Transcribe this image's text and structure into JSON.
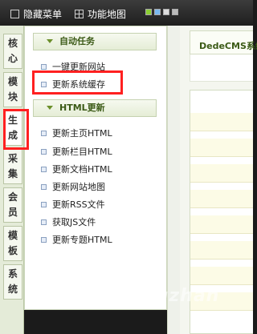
{
  "topbar": {
    "hide_menu": "隐藏菜单",
    "site_map": "功能地图",
    "swatch_colors": [
      "#8ccf34",
      "#7ab8ef",
      "#dddddd",
      "#bbbbbb"
    ]
  },
  "leftnav": {
    "tabs": [
      {
        "label": "核心"
      },
      {
        "label": "模块"
      },
      {
        "label": "生成"
      },
      {
        "label": "采集"
      },
      {
        "label": "会员"
      },
      {
        "label": "模板"
      },
      {
        "label": "系统"
      }
    ]
  },
  "menu": {
    "groups": [
      {
        "title": "自动任务",
        "items": [
          "一键更新网站",
          "更新系统缓存"
        ]
      },
      {
        "title": "HTML更新",
        "items": [
          "更新主页HTML",
          "更新栏目HTML",
          "更新文档HTML",
          "更新网站地图",
          "更新RSS文件",
          "获取JS文件",
          "更新专题HTML"
        ]
      }
    ]
  },
  "main": {
    "title": "DedeCMS系统"
  },
  "watermark": "xuewangzhan",
  "colors": {
    "highlight": "#ff2020",
    "group_text": "#3b5a16"
  }
}
